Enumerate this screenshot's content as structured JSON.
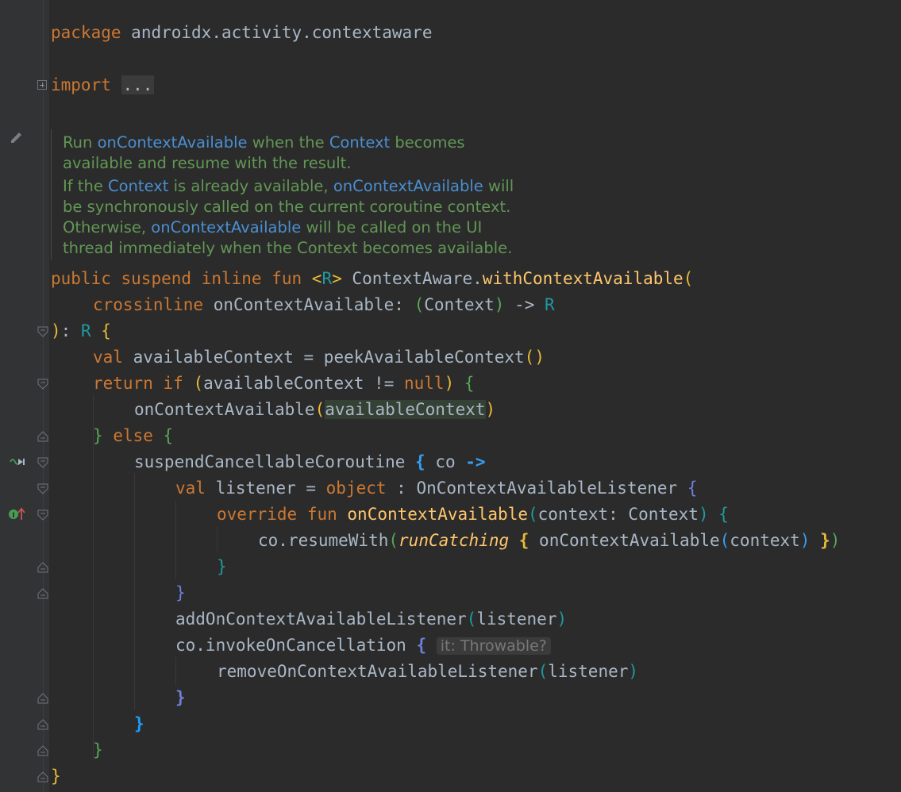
{
  "code": {
    "package_kw": "package",
    "package_name": "androidx.activity.contextaware",
    "import_kw": "import",
    "import_folded": "...",
    "doc": {
      "l1a": "Run ",
      "l1b": "onContextAvailable",
      "l1c": " when the ",
      "l1d": "Context",
      "l1e": " becomes",
      "l2": "available and resume with the result.",
      "l3a": "If the ",
      "l3b": "Context",
      "l3c": " is already available, ",
      "l3d": "onContextAvailable",
      "l3e": " will",
      "l4": "be synchronously called on the current coroutine context.",
      "l5a": "Otherwise, ",
      "l5b": "onContextAvailable",
      "l5c": " will be called on the UI",
      "l6": "thread immediately when the Context becomes available."
    },
    "sig": {
      "public": "public",
      "suspend": "suspend",
      "inline": "inline",
      "fun": "fun",
      "lt": "<",
      "r": "R",
      "gt": ">",
      "recv": "ContextAware.",
      "name": "withContextAvailable",
      "open": "("
    },
    "param": {
      "crossinline": "crossinline",
      "name": "onContextAvailable: ",
      "popen": "(",
      "ptype": "Context",
      "pclose": ")",
      "arrow": " -> ",
      "ret": "R"
    },
    "sig_end": {
      "close": ")",
      "colon": ": ",
      "r": "R",
      "brace": "{"
    },
    "l_val": {
      "val": "val",
      "rest": " availableContext = peekAvailableContext",
      "parens": "()"
    },
    "l_return": {
      "return": "return",
      "if": "if",
      "open": "(",
      "cond": "availableContext != ",
      "null": "null",
      "close": ")",
      "brace": "{"
    },
    "l_call": {
      "fn": "onContextAvailable",
      "open": "(",
      "arg": "availableContext",
      "close": ")"
    },
    "l_else": {
      "close": "}",
      "else": "else",
      "open": "{"
    },
    "l_susp": {
      "fn": "suspendCancellableCoroutine ",
      "brace": "{",
      "co": " co ",
      "arrow": "->"
    },
    "l_listener": {
      "val": "val",
      "rest": " listener = ",
      "object": "object",
      "type": " : OnContextAvailableListener ",
      "brace": "{"
    },
    "l_override": {
      "override": "override",
      "fun": "fun",
      "name": "onContextAvailable",
      "open": "(",
      "params": "context: Context",
      "close": ")",
      "brace": "{"
    },
    "l_resume": {
      "recv": "co.resumeWith",
      "open": "(",
      "run": "runCatching",
      "brace": " { ",
      "call": "onContextAvailable",
      "iopen": "(",
      "arg": "context",
      "iclose": ")",
      "bclose": " }",
      "close": ")"
    },
    "l_close1": "}",
    "l_close2": "}",
    "l_add": {
      "fn": "addOnContextAvailableListener",
      "open": "(",
      "arg": "listener",
      "close": ")"
    },
    "l_cancel": {
      "fn": "co.invokeOnCancellation ",
      "brace": "{",
      "hint": "it: Throwable?"
    },
    "l_remove": {
      "fn": "removeOnContextAvailableListener",
      "open": "(",
      "arg": "listener",
      "close": ")"
    },
    "l_close3": "}",
    "l_close4": "}",
    "l_close5": "}",
    "l_close6": "}"
  },
  "icons": {
    "edit": "pencil-icon",
    "suspend_call": "suspend-call-icon",
    "implements": "implements-icon"
  }
}
